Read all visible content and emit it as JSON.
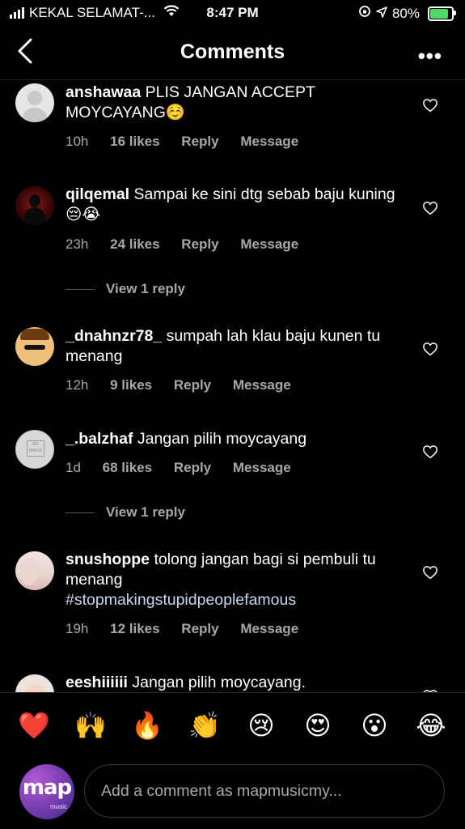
{
  "status_bar": {
    "carrier": "KEKAL SELAMAT-...",
    "time": "8:47 PM",
    "battery": "80%",
    "battery_level": 0.8
  },
  "header": {
    "title": "Comments",
    "more": "•••"
  },
  "comments": [
    {
      "username": "anshawaa",
      "text": "PLIS JANGAN ACCEPT MOYCAYANG☺️",
      "age": "10h",
      "likes": "16 likes",
      "reply": "Reply",
      "message": "Message"
    },
    {
      "username": "qilqemal",
      "text": "Sampai ke sini dtg sebab baju kuning 😔😭",
      "age": "23h",
      "likes": "24 likes",
      "reply": "Reply",
      "message": "Message",
      "view_replies": "View 1 reply"
    },
    {
      "username": "_dnahnzr78_",
      "text": "sumpah lah klau baju kunen tu menang",
      "age": "12h",
      "likes": "9 likes",
      "reply": "Reply",
      "message": "Message"
    },
    {
      "username": "_.balzhaf",
      "text": "Jangan pilih moycayang",
      "age": "1d",
      "likes": "68 likes",
      "reply": "Reply",
      "message": "Message",
      "view_replies": "View 1 reply"
    },
    {
      "username": "snushoppe",
      "text": "tolong jangan bagi si pembuli tu menang",
      "hashtag": "#stopmakingstupidpeoplefamous",
      "age": "19h",
      "likes": "12 likes",
      "reply": "Reply",
      "message": "Message"
    },
    {
      "username": "eeshiiiiii",
      "text": "Jangan pilih moycayang."
    }
  ],
  "emoji_bar": [
    "❤️",
    "🙌",
    "🔥",
    "👏",
    "😢",
    "😍",
    "😮",
    "😂"
  ],
  "composer": {
    "avatar_logo": "map",
    "avatar_sub": "music",
    "placeholder": "Add a comment as mapmusicmy..."
  }
}
